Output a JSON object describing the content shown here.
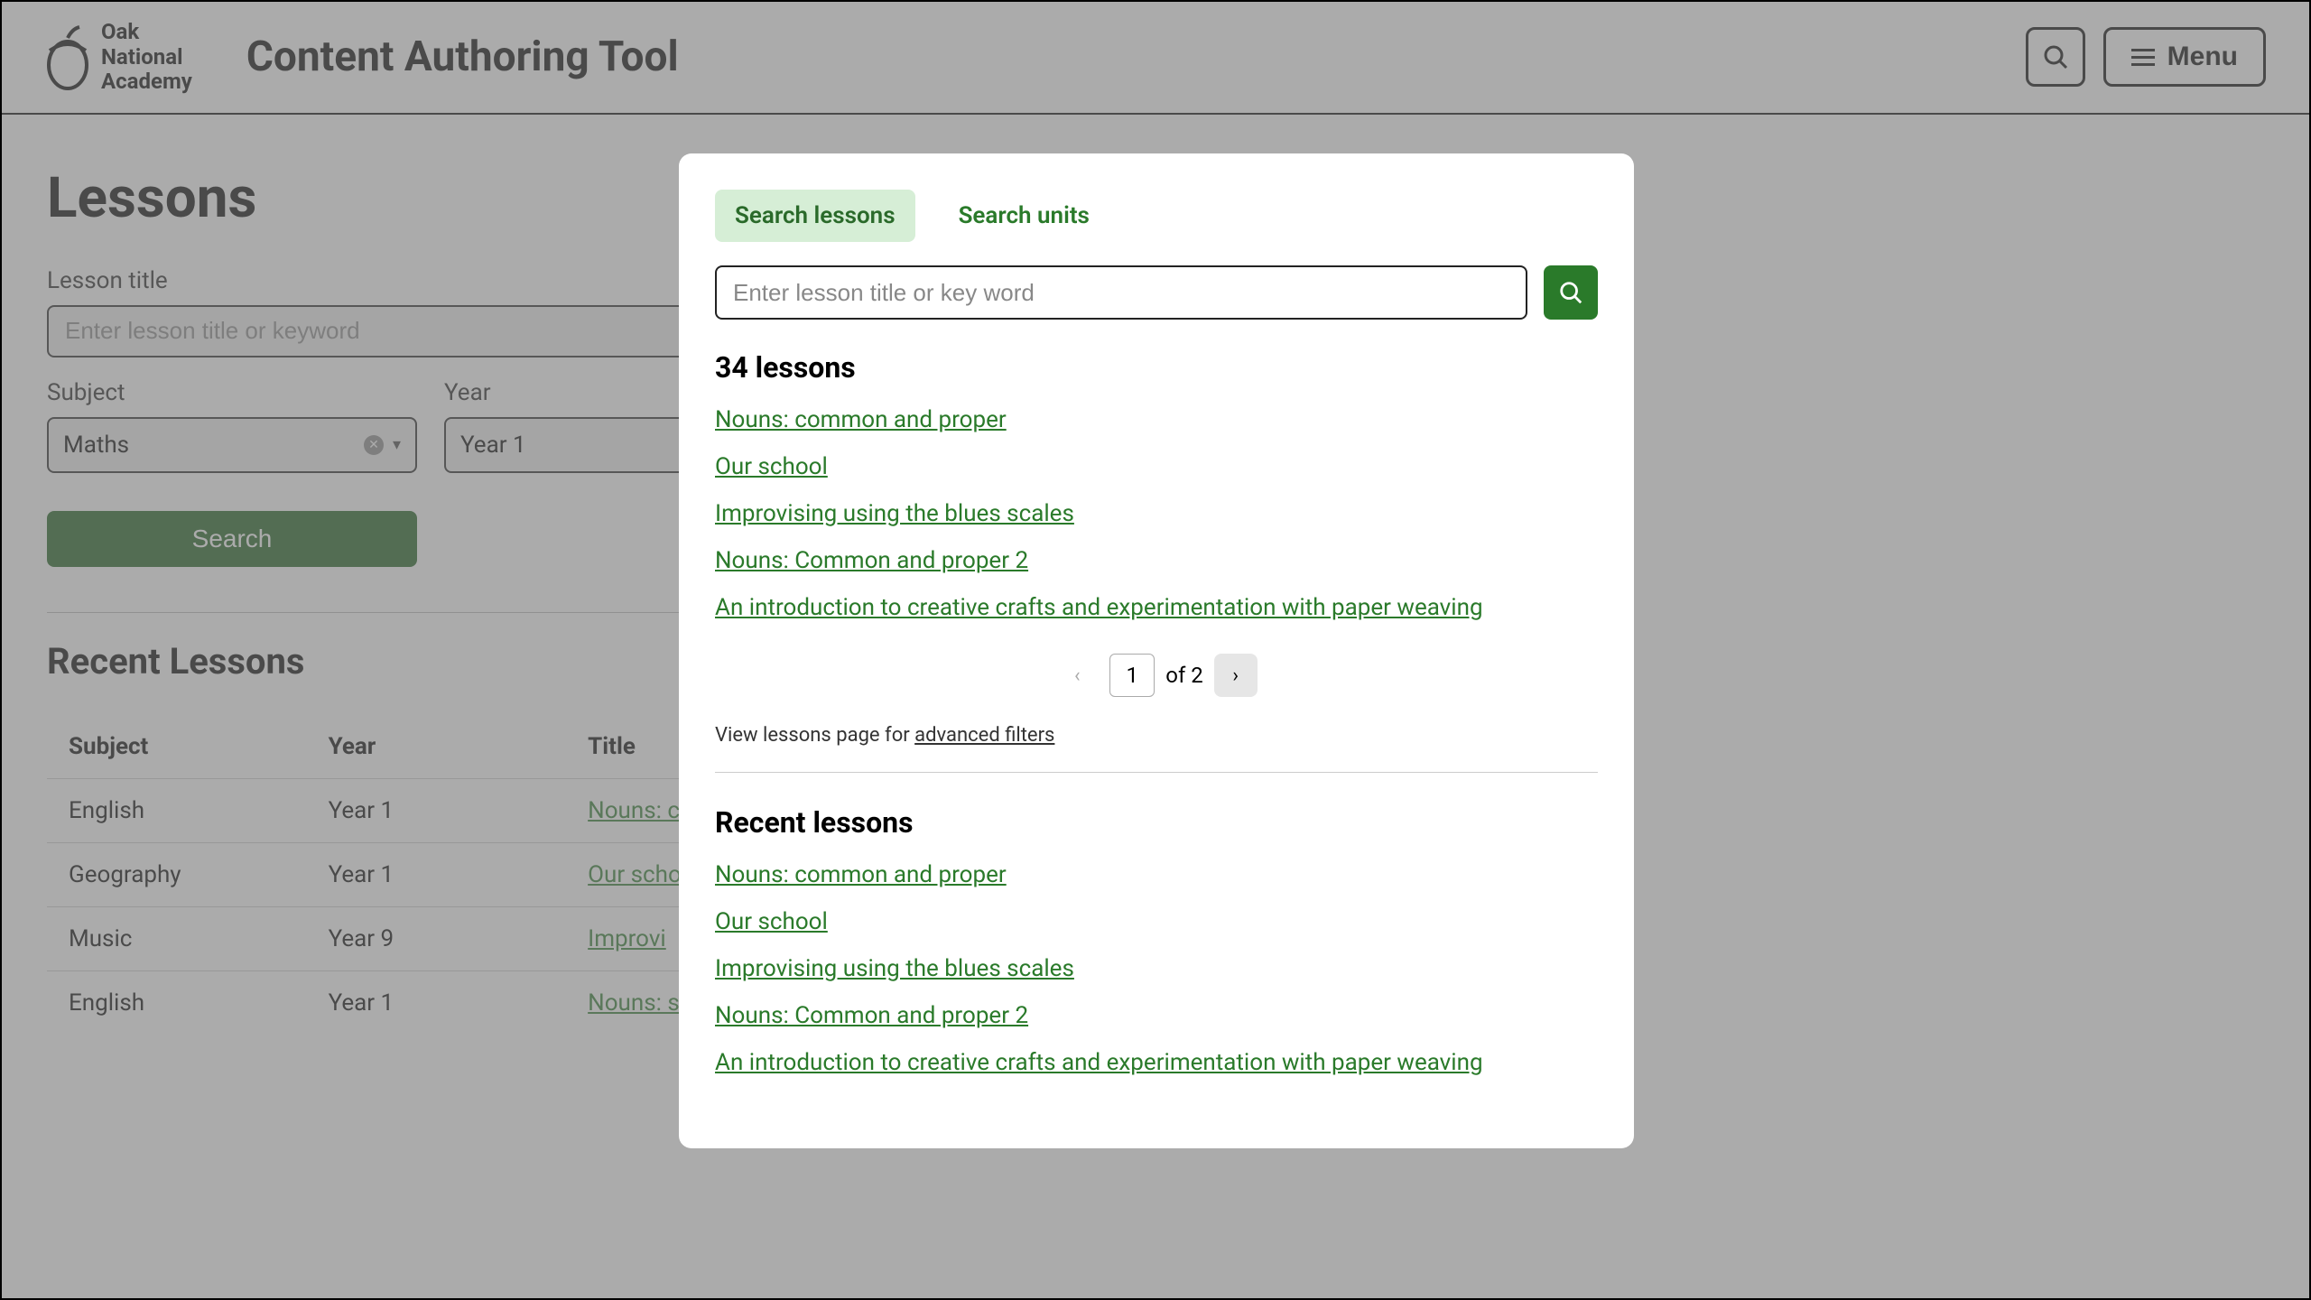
{
  "header": {
    "brand_line1": "Oak",
    "brand_line2": "National",
    "brand_line3": "Academy",
    "app_title": "Content Authoring Tool",
    "menu_label": "Menu"
  },
  "page": {
    "title": "Lessons",
    "lesson_title_label": "Lesson title",
    "lesson_title_placeholder": "Enter lesson title or keyword",
    "subject_label": "Subject",
    "subject_value": "Maths",
    "year_label": "Year",
    "year_value": "Year 1",
    "search_button": "Search"
  },
  "recent": {
    "heading": "Recent Lessons",
    "columns": {
      "subject": "Subject",
      "year": "Year",
      "title": "Title"
    },
    "rows": [
      {
        "subject": "English",
        "year": "Year 1",
        "title": "Nouns: c"
      },
      {
        "subject": "Geography",
        "year": "Year 1",
        "title": "Our scho"
      },
      {
        "subject": "Music",
        "year": "Year 9",
        "title": "Improvi"
      },
      {
        "subject": "English",
        "year": "Year 1",
        "title": "Nouns: s"
      }
    ]
  },
  "modal": {
    "tabs": {
      "lessons": "Search lessons",
      "units": "Search units"
    },
    "search_placeholder": "Enter lesson title or key word",
    "results_heading": "34 lessons",
    "results": [
      "Nouns: common and proper",
      "Our school",
      "Improvising using the blues scales",
      "Nouns: Common and proper 2",
      "An introduction to creative crafts and experimentation with paper weaving"
    ],
    "page_current": "1",
    "page_of": "of 2",
    "view_more_prefix": "View lessons page for ",
    "view_more_link": "advanced filters",
    "recent_heading": "Recent lessons",
    "recent": [
      "Nouns: common and proper",
      "Our school",
      "Improvising using the blues scales",
      "Nouns: Common and proper 2",
      "An introduction to creative crafts and experimentation with paper weaving"
    ]
  }
}
